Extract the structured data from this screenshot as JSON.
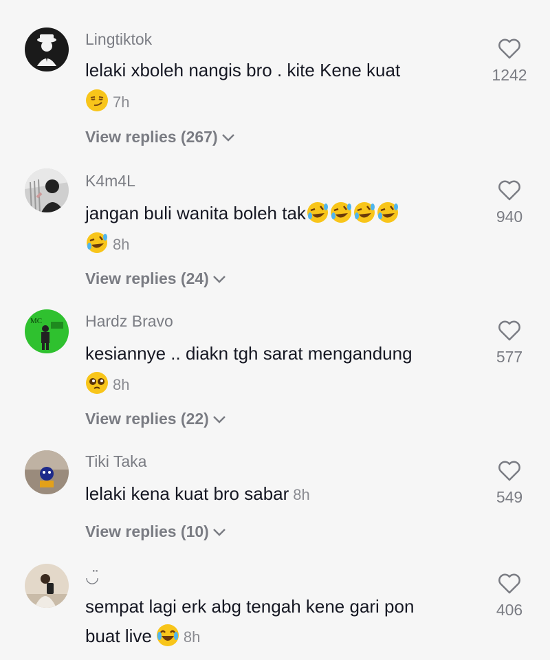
{
  "comments": [
    {
      "username": "Lingtiktok",
      "line1": "lelaki xboleh nangis bro . kite Kene kuat",
      "line2_emoji": [
        "smirk"
      ],
      "time": "7h",
      "replies": "View replies (267)",
      "likes": "1242",
      "avatar_color": "#1a1a1a"
    },
    {
      "username": "K4m4L",
      "line1": "jangan buli wanita boleh tak",
      "line1_emoji": [
        "rofl",
        "rofl",
        "rofl",
        "rofl"
      ],
      "line2_emoji": [
        "rofl"
      ],
      "time": "8h",
      "replies": "View replies (24)",
      "likes": "940",
      "avatar_color": "#555555"
    },
    {
      "username": "Hardz Bravo",
      "line1": "kesiannye .. diakn tgh sarat mengandung",
      "line2_emoji": [
        "pleading"
      ],
      "time": "8h",
      "replies": "View replies (22)",
      "likes": "577",
      "avatar_color": "#2fc12f"
    },
    {
      "username": "Tiki Taka",
      "line1": "lelaki kena kuat bro sabar",
      "time": "8h",
      "replies": "View replies (10)",
      "likes": "549",
      "avatar_color": "#8a7a6a"
    },
    {
      "username": "◡̈",
      "line1": "sempat lagi erk abg tengah kene gari pon",
      "line2": "buat live",
      "line2_emoji": [
        "joy"
      ],
      "time": "8h",
      "likes": "406",
      "avatar_color": "#d9cdbd"
    }
  ],
  "icons": {
    "like": "heart-outline-icon",
    "chevron": "chevron-down-icon"
  },
  "colors": {
    "background": "#f6f6f6",
    "muted": "#7a7c83",
    "text": "#161823"
  }
}
